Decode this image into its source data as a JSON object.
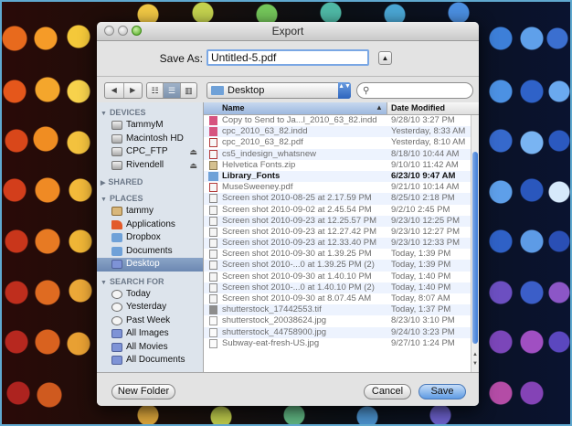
{
  "window": {
    "title": "Export"
  },
  "save_as": {
    "label": "Save As:",
    "filename": "Untitled-5.pdf"
  },
  "toolbar": {
    "back_glyph": "◀",
    "forward_glyph": "▶",
    "view_icons": [
      "☷",
      "☰",
      "▥"
    ],
    "location": "Desktop",
    "location_arrows": "▲▼",
    "search_placeholder": "",
    "expand_glyph": "▲"
  },
  "sidebar": {
    "devices": {
      "header": "DEVICES",
      "items": [
        {
          "label": "TammyM",
          "icon": "drive-icon",
          "eject": ""
        },
        {
          "label": "Macintosh HD",
          "icon": "drive-icon",
          "eject": ""
        },
        {
          "label": "CPC_FTP",
          "icon": "drive-icon",
          "eject": "⏏"
        },
        {
          "label": "Rivendell",
          "icon": "drive-icon",
          "eject": "⏏"
        }
      ]
    },
    "shared": {
      "header": "SHARED"
    },
    "places": {
      "header": "PLACES",
      "items": [
        {
          "label": "tammy",
          "icon": "home-icon"
        },
        {
          "label": "Applications",
          "icon": "applications-icon"
        },
        {
          "label": "Dropbox",
          "icon": "folder-icon"
        },
        {
          "label": "Documents",
          "icon": "folder-icon"
        },
        {
          "label": "Desktop",
          "icon": "desktop-icon",
          "selected": true
        }
      ]
    },
    "search_for": {
      "header": "SEARCH FOR",
      "items": [
        {
          "label": "Today",
          "icon": "clock-icon"
        },
        {
          "label": "Yesterday",
          "icon": "clock-icon"
        },
        {
          "label": "Past Week",
          "icon": "clock-icon"
        },
        {
          "label": "All Images",
          "icon": "smart-folder-icon"
        },
        {
          "label": "All Movies",
          "icon": "smart-folder-icon"
        },
        {
          "label": "All Documents",
          "icon": "smart-folder-icon"
        }
      ]
    }
  },
  "file_list": {
    "columns": {
      "name": "Name",
      "date": "Date Modified",
      "sort_glyph": "▲"
    },
    "rows": [
      {
        "name": "Copy to Send to Ja...l_2010_63_82.indd",
        "date": "9/28/10 3:27 PM",
        "type": "indd"
      },
      {
        "name": "cpc_2010_63_82.indd",
        "date": "Yesterday, 8:33 AM",
        "type": "indd"
      },
      {
        "name": "cpc_2010_63_82.pdf",
        "date": "Yesterday, 8:10 AM",
        "type": "pdf"
      },
      {
        "name": "cs5_indesign_whatsnew",
        "date": "8/18/10 10:44 AM",
        "type": "pdf"
      },
      {
        "name": "Helvetica Fonts.zip",
        "date": "9/10/10 11:42 AM",
        "type": "zip"
      },
      {
        "name": "Library_Fonts",
        "date": "6/23/10 9:47 AM",
        "type": "folder",
        "enabled": true
      },
      {
        "name": "MuseSweeney.pdf",
        "date": "9/21/10 10:14 AM",
        "type": "pdf"
      },
      {
        "name": "Screen shot 2010-08-25 at 2.17.59 PM",
        "date": "8/25/10 2:18 PM",
        "type": "png"
      },
      {
        "name": "Screen shot 2010-09-02 at 2.45.54 PM",
        "date": "9/2/10 2:45 PM",
        "type": "png"
      },
      {
        "name": "Screen shot 2010-09-23 at 12.25.57 PM",
        "date": "9/23/10 12:25 PM",
        "type": "png"
      },
      {
        "name": "Screen shot 2010-09-23 at 12.27.42 PM",
        "date": "9/23/10 12:27 PM",
        "type": "png"
      },
      {
        "name": "Screen shot 2010-09-23 at 12.33.40 PM",
        "date": "9/23/10 12:33 PM",
        "type": "png"
      },
      {
        "name": "Screen shot 2010-09-30 at 1.39.25 PM",
        "date": "Today, 1:39 PM",
        "type": "png"
      },
      {
        "name": "Screen shot 2010-...0 at 1.39.25 PM (2)",
        "date": "Today, 1:39 PM",
        "type": "png"
      },
      {
        "name": "Screen shot 2010-09-30 at 1.40.10 PM",
        "date": "Today, 1:40 PM",
        "type": "png"
      },
      {
        "name": "Screen shot 2010-...0 at 1.40.10 PM (2)",
        "date": "Today, 1:40 PM",
        "type": "png"
      },
      {
        "name": "Screen shot 2010-09-30 at 8.07.45 AM",
        "date": "Today, 8:07 AM",
        "type": "png"
      },
      {
        "name": "shutterstock_17442553.tif",
        "date": "Today, 1:37 PM",
        "type": "tif"
      },
      {
        "name": "shutterstock_20038624.jpg",
        "date": "8/23/10 3:10 PM",
        "type": "jpg"
      },
      {
        "name": "shutterstock_44758900.jpg",
        "date": "9/24/10 3:23 PM",
        "type": "jpg"
      },
      {
        "name": "Subway-eat-fresh-US.jpg",
        "date": "9/27/10 1:24 PM",
        "type": "jpg"
      }
    ]
  },
  "footer": {
    "new_folder": "New Folder",
    "cancel": "Cancel",
    "save": "Save"
  },
  "colors": {
    "accent": "#5e9be3",
    "selection": "#7790b8",
    "sidebar_bg": "#dde4ec",
    "row_alt": "#edf3fe"
  }
}
